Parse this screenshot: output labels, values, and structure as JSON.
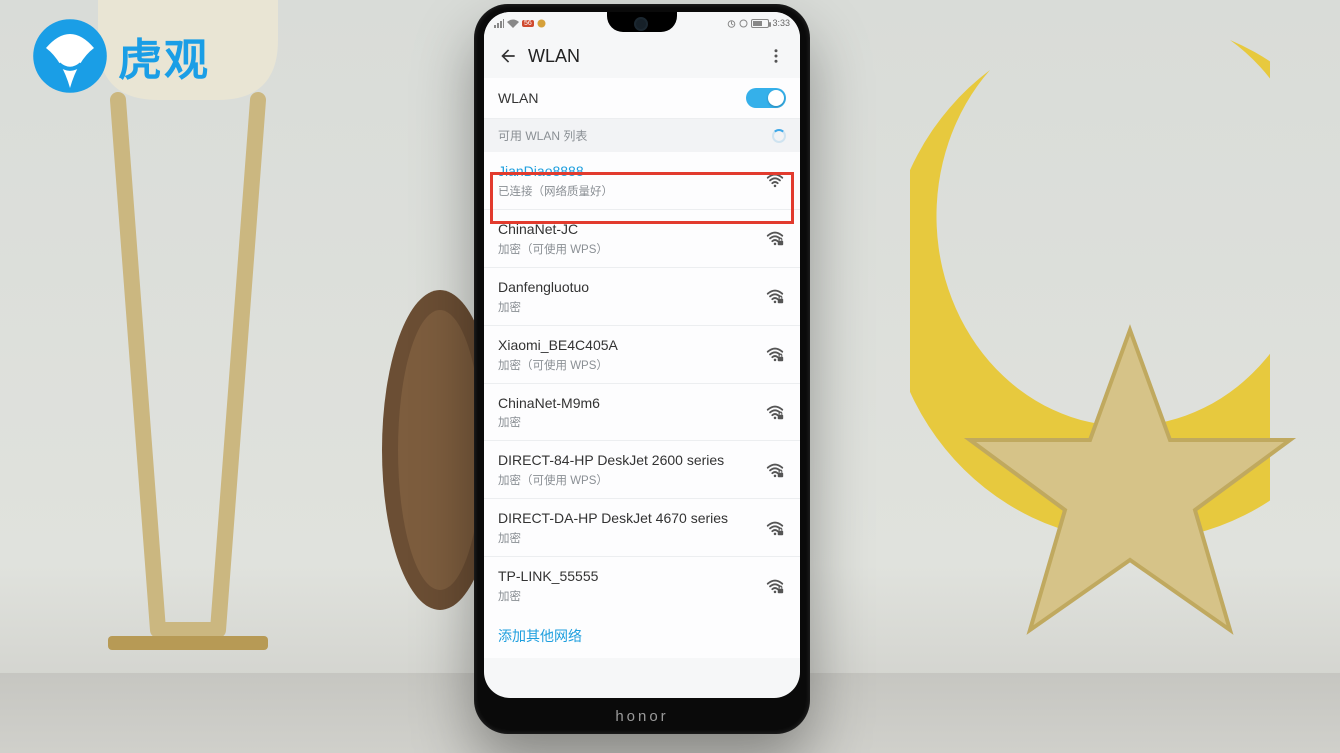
{
  "watermark": {
    "text": "虎观"
  },
  "phone": {
    "brand": "honor"
  },
  "status": {
    "time": "3:33",
    "network_badge": "56"
  },
  "appbar": {
    "title": "WLAN"
  },
  "wlan_master": {
    "label": "WLAN",
    "enabled": true
  },
  "section_header": "可用 WLAN 列表",
  "networks": [
    {
      "ssid": "JianDiao8888",
      "sub": "已连接（网络质量好）",
      "connected": true,
      "locked": false
    },
    {
      "ssid": "ChinaNet-JC",
      "sub": "加密（可使用 WPS）",
      "connected": false,
      "locked": true
    },
    {
      "ssid": "Danfengluotuo",
      "sub": "加密",
      "connected": false,
      "locked": true
    },
    {
      "ssid": "Xiaomi_BE4C405A",
      "sub": "加密（可使用 WPS）",
      "connected": false,
      "locked": true
    },
    {
      "ssid": "ChinaNet-M9m6",
      "sub": "加密",
      "connected": false,
      "locked": true
    },
    {
      "ssid": "DIRECT-84-HP DeskJet 2600 series",
      "sub": "加密（可使用 WPS）",
      "connected": false,
      "locked": true
    },
    {
      "ssid": "DIRECT-DA-HP DeskJet 4670 series",
      "sub": "加密",
      "connected": false,
      "locked": true
    },
    {
      "ssid": "TP-LINK_55555",
      "sub": "加密",
      "connected": false,
      "locked": true
    }
  ],
  "footer_link": "添加其他网络",
  "colors": {
    "accent": "#1E9FDE",
    "highlight": "#e23b2e"
  }
}
